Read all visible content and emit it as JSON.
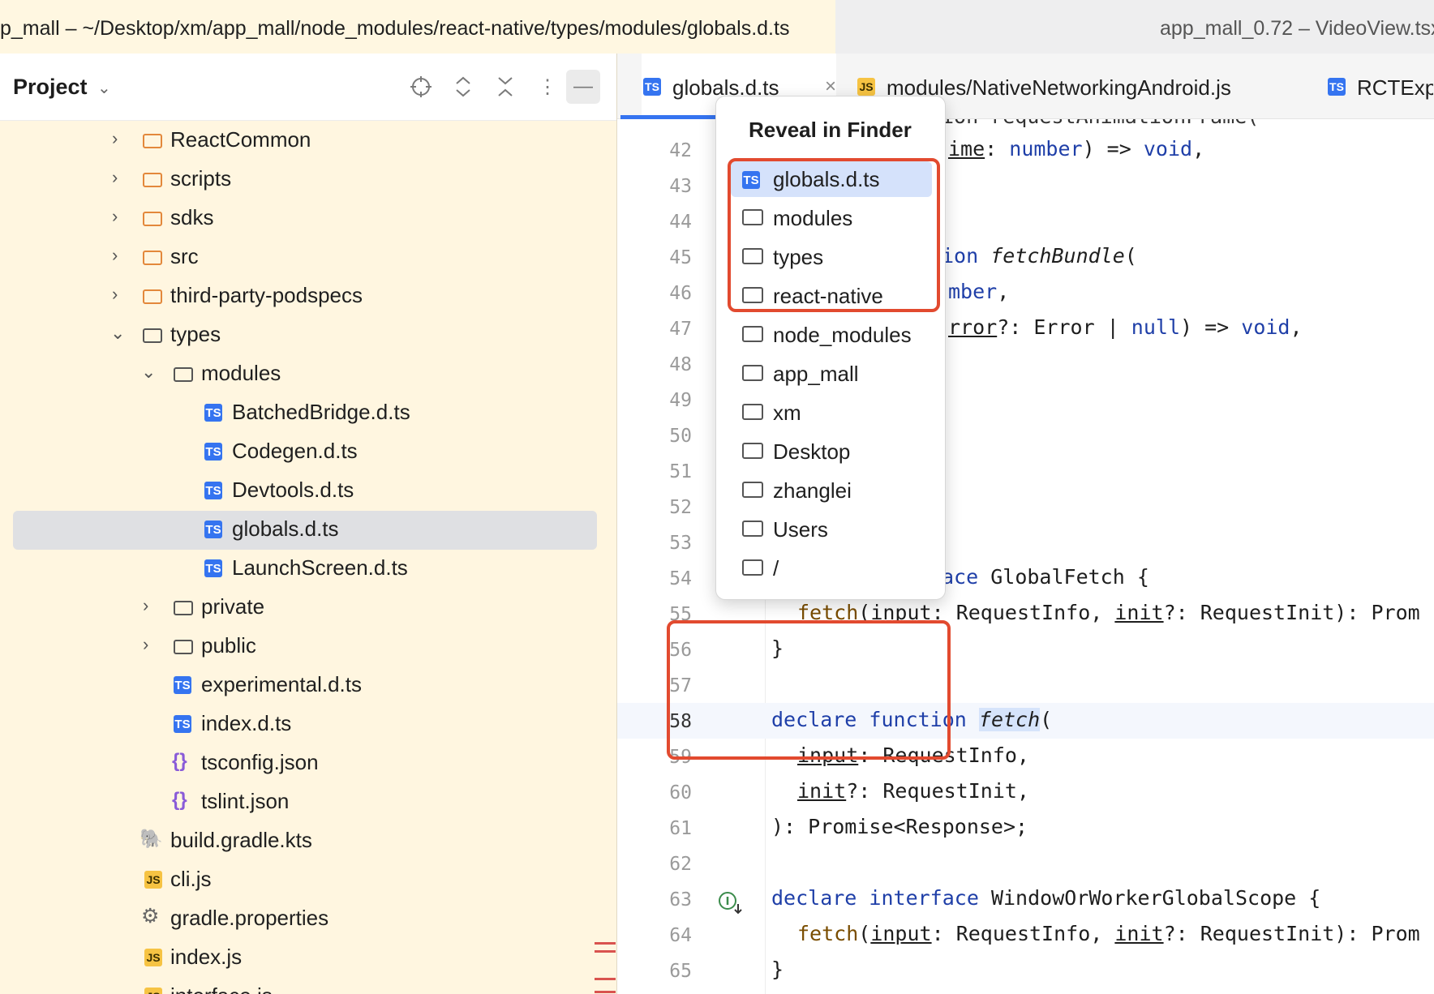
{
  "window": {
    "title_left": "p_mall – ~/Desktop/xm/app_mall/node_modules/react-native/types/modules/globals.d.ts",
    "title_right": "app_mall_0.72 – VideoView.tsx"
  },
  "project": {
    "title": "Project",
    "tree": [
      {
        "label": "ReactCommon",
        "type": "folder"
      },
      {
        "label": "scripts",
        "type": "folder"
      },
      {
        "label": "sdks",
        "type": "folder"
      },
      {
        "label": "src",
        "type": "folder"
      },
      {
        "label": "third-party-podspecs",
        "type": "folder"
      },
      {
        "label": "types",
        "type": "folder"
      },
      {
        "label": "modules",
        "type": "folder"
      },
      {
        "label": "BatchedBridge.d.ts",
        "type": "ts"
      },
      {
        "label": "Codegen.d.ts",
        "type": "ts"
      },
      {
        "label": "Devtools.d.ts",
        "type": "ts"
      },
      {
        "label": "globals.d.ts",
        "type": "ts"
      },
      {
        "label": "LaunchScreen.d.ts",
        "type": "ts"
      },
      {
        "label": "private",
        "type": "folder"
      },
      {
        "label": "public",
        "type": "folder"
      },
      {
        "label": "experimental.d.ts",
        "type": "ts"
      },
      {
        "label": "index.d.ts",
        "type": "ts"
      },
      {
        "label": "tsconfig.json",
        "type": "json"
      },
      {
        "label": "tslint.json",
        "type": "json"
      },
      {
        "label": "build.gradle.kts",
        "type": "gradle"
      },
      {
        "label": "cli.js",
        "type": "js"
      },
      {
        "label": "gradle.properties",
        "type": "gear"
      },
      {
        "label": "index.js",
        "type": "js"
      },
      {
        "label": "interface.js",
        "type": "js"
      }
    ]
  },
  "tabs": [
    {
      "label": "globals.d.ts",
      "icon": "TS"
    },
    {
      "label": "modules/NativeNetworkingAndroid.js",
      "icon": "JS"
    },
    {
      "label": "RCTExpo",
      "icon": "TS"
    }
  ],
  "popup": {
    "title": "Reveal in Finder",
    "items": [
      "globals.d.ts",
      "modules",
      "types",
      "react-native",
      "node_modules",
      "app_mall",
      "xm",
      "Desktop",
      "zhanglei",
      "Users",
      "/"
    ],
    "icon_ts_label": "TS"
  },
  "icon_labels": {
    "ts": "TS",
    "js": "JS",
    "json": "{}",
    "gear": "⚙",
    "gradle": "🐘"
  },
  "editor": {
    "line_numbers": [
      "42",
      "43",
      "44",
      "45",
      "46",
      "47",
      "48",
      "49",
      "50",
      "51",
      "52",
      "53",
      "54",
      "55",
      "56",
      "57",
      "58",
      "59",
      "60",
      "61",
      "62",
      "63",
      "64",
      "65"
    ],
    "code": {
      "l41": "ion requestAnimationFrame(",
      "l42a": "ime",
      "l42b": ": ",
      "l42c": "number",
      "l42d": ") => ",
      "l42e": "void",
      "l42f": ",",
      "l45a": "ion ",
      "l45b": "fetchBundle",
      "l45c": "(",
      "l46a": "mber",
      "l46b": ",",
      "l47a": "rror",
      "l47b": "?: Error | ",
      "l47c": "null",
      "l47d": ") => ",
      "l47e": "void",
      "l47f": ",",
      "l54a": "ace ",
      "l54b": "GlobalFetch {",
      "l55a": "fetch",
      "l55b": "(",
      "l55c": "input",
      "l55d": ": RequestInfo, ",
      "l55e": "init",
      "l55f": "?: RequestInit): Prom",
      "l56": "}",
      "l58a": "declare ",
      "l58b": "function ",
      "l58c": "fetch",
      "l58d": "(",
      "l59a": "input",
      "l59b": ": RequestInfo,",
      "l60a": "init",
      "l60b": "?: RequestInit,",
      "l61": "): Promise<Response>;",
      "l63a": "declare ",
      "l63b": "interface ",
      "l63c": "WindowOrWorkerGlobalScope {",
      "l64a": "fetch",
      "l64b": "(",
      "l64c": "input",
      "l64d": ": RequestInfo, ",
      "l64e": "init",
      "l64f": "?: RequestInit): Prom",
      "l65": "}"
    }
  }
}
